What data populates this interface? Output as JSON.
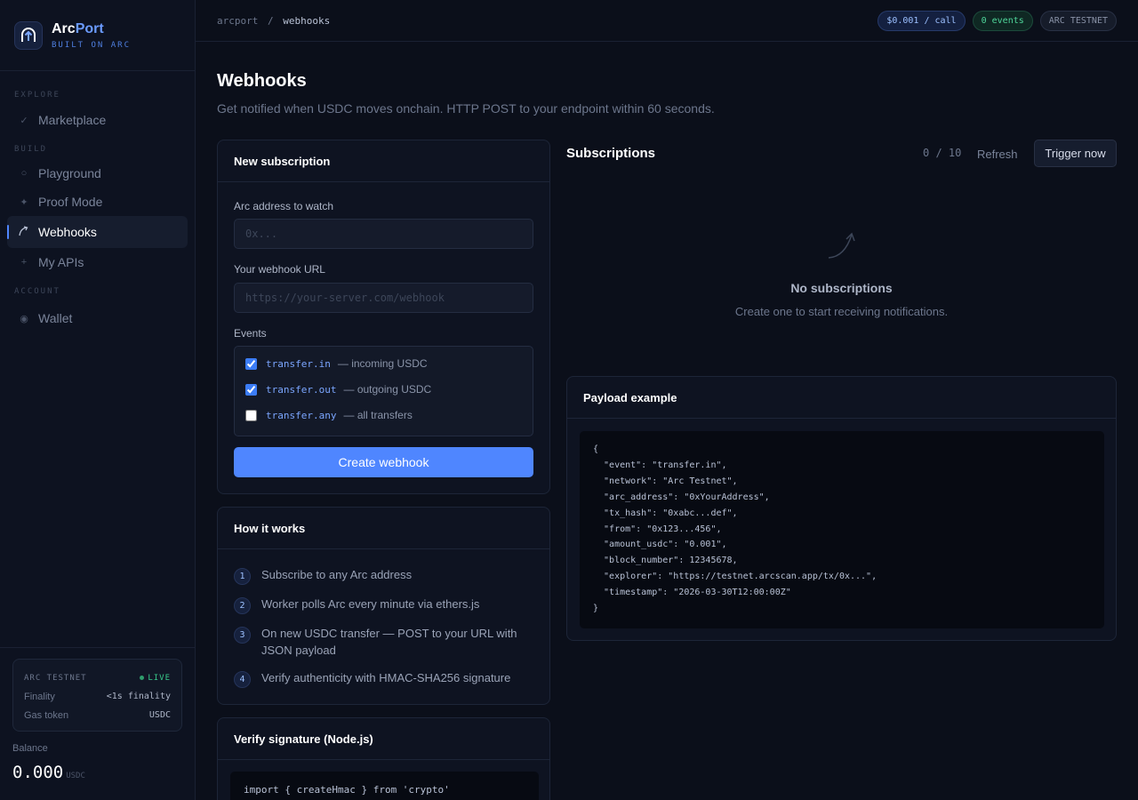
{
  "app": {
    "name_main": "Arc",
    "name_accent": "Port",
    "tagline": "BUILT ON ARC"
  },
  "sidebar": {
    "sections": {
      "explore": "EXPLORE",
      "build": "BUILD",
      "account": "ACCOUNT"
    },
    "items": [
      {
        "label": "Marketplace",
        "icon": "check-icon",
        "active": false
      },
      {
        "label": "Playground",
        "icon": "circle-icon",
        "active": false
      },
      {
        "label": "Proof Mode",
        "icon": "sparkle-icon",
        "active": false
      },
      {
        "label": "Webhooks",
        "icon": "arrow-curve-icon",
        "active": true
      },
      {
        "label": "My APIs",
        "icon": "plus-icon",
        "active": false
      },
      {
        "label": "Wallet",
        "icon": "wallet-icon",
        "active": false
      }
    ],
    "network": {
      "name": "ARC TESTNET",
      "status": "LIVE",
      "finality_label": "Finality",
      "finality_value": "<1s finality",
      "gas_label": "Gas token",
      "gas_value": "USDC"
    },
    "balance": {
      "label": "Balance",
      "value": "0.000",
      "unit": "USDC"
    }
  },
  "topbar": {
    "breadcrumb_root": "arcport",
    "breadcrumb_sep": "/",
    "breadcrumb_current": "webhooks",
    "price_pill": "$0.001 / call",
    "events_pill": "0 events",
    "network_pill": "ARC TESTNET"
  },
  "page": {
    "title": "Webhooks",
    "subtitle": "Get notified when USDC moves onchain. HTTP POST to your endpoint within 60 seconds."
  },
  "new_subscription": {
    "title": "New subscription",
    "address_label": "Arc address to watch",
    "address_placeholder": "0x...",
    "address_value": "",
    "url_label": "Your webhook URL",
    "url_placeholder": "https://your-server.com/webhook",
    "url_value": "",
    "events_label": "Events",
    "events": [
      {
        "code": "transfer.in",
        "desc": "— incoming USDC",
        "checked": true
      },
      {
        "code": "transfer.out",
        "desc": "— outgoing USDC",
        "checked": true
      },
      {
        "code": "transfer.any",
        "desc": "— all transfers",
        "checked": false
      }
    ],
    "submit_label": "Create webhook"
  },
  "how_it_works": {
    "title": "How it works",
    "steps": [
      {
        "num": "1",
        "text": "Subscribe to any Arc address"
      },
      {
        "num": "2",
        "text": "Worker polls Arc every minute via ethers.js"
      },
      {
        "num": "3",
        "text": "On new USDC transfer — POST to your URL with JSON payload"
      },
      {
        "num": "4",
        "text": "Verify authenticity with HMAC-SHA256 signature"
      }
    ]
  },
  "verify": {
    "title": "Verify signature (Node.js)",
    "code_first_line": "import { createHmac } from 'crypto'"
  },
  "subscriptions": {
    "title": "Subscriptions",
    "counter": "0 / 10",
    "refresh_label": "Refresh",
    "trigger_label": "Trigger now",
    "empty_title": "No subscriptions",
    "empty_sub": "Create one to start receiving notifications."
  },
  "payload": {
    "title": "Payload example",
    "code": "{\n  \"event\": \"transfer.in\",\n  \"network\": \"Arc Testnet\",\n  \"arc_address\": \"0xYourAddress\",\n  \"tx_hash\": \"0xabc...def\",\n  \"from\": \"0x123...456\",\n  \"amount_usdc\": \"0.001\",\n  \"block_number\": 12345678,\n  \"explorer\": \"https://testnet.arcscan.app/tx/0x...\",\n  \"timestamp\": \"2026-03-30T12:00:00Z\"\n}"
  },
  "colors": {
    "accent": "#4f86ff",
    "background": "#0b0f1a",
    "live": "#38c98a"
  }
}
